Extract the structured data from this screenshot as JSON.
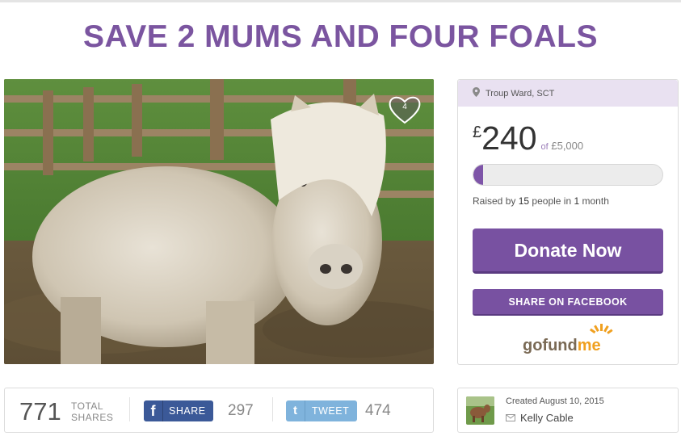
{
  "campaign": {
    "title": "SAVE 2 MUMS AND FOUR FOALS",
    "likes_count": "4"
  },
  "donate": {
    "location": "Troup Ward, SCT",
    "currency_symbol": "£",
    "raised_amount": "240",
    "goal_text": "£5,000",
    "of_text": "of",
    "progress_fraction": 0.048,
    "raised_prefix": "Raised by",
    "people_count": "15",
    "people_word": "people in",
    "time_count": "1",
    "time_unit": "month",
    "donate_label": "Donate Now",
    "share_facebook_label": "SHARE ON FACEBOOK",
    "brand_go": "gofund",
    "brand_me": "me"
  },
  "shares": {
    "total": "771",
    "total_label_1": "TOTAL",
    "total_label_2": "SHARES",
    "facebook_label": "SHARE",
    "facebook_count": "297",
    "twitter_label": "TWEET",
    "twitter_count": "474"
  },
  "creator": {
    "created_text": "Created August 10, 2015",
    "name": "Kelly Cable"
  },
  "icons": {
    "location": "map-pin-icon",
    "heart": "heart-icon",
    "facebook": "facebook-f-icon",
    "twitter": "twitter-t-icon",
    "mail": "envelope-icon"
  },
  "colors": {
    "brand_purple": "#7851a1",
    "title_purple": "#7b55a0",
    "facebook_blue": "#3b5998",
    "twitter_blue": "#7fb3dc"
  }
}
